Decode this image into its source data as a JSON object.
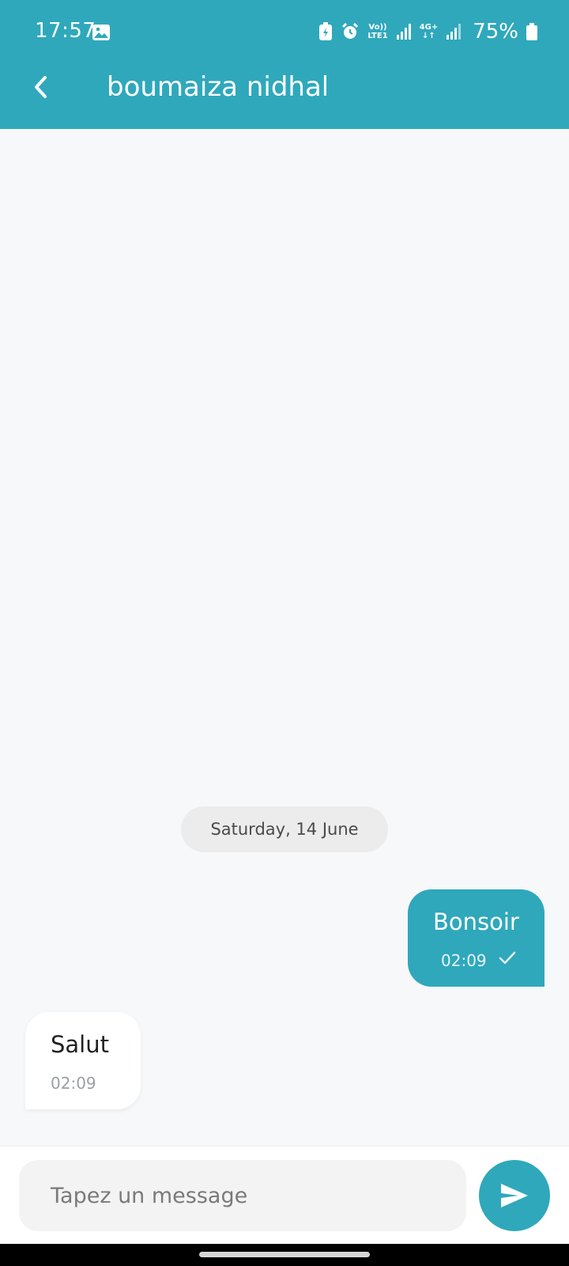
{
  "status_bar": {
    "time": "17:57",
    "volte_top": "Vo))",
    "volte_bottom": "LTE1",
    "network_top": "4G+",
    "network_bottom": "↓↑",
    "battery_percent": "75%"
  },
  "header": {
    "title": "boumaiza nidhal"
  },
  "conversation": {
    "date_separator": "Saturday, 14 June",
    "messages": [
      {
        "direction": "outgoing",
        "text": "Bonsoir",
        "time": "02:09",
        "status": "sent"
      },
      {
        "direction": "incoming",
        "text": "Salut",
        "time": "02:09"
      }
    ]
  },
  "composer": {
    "placeholder": "Tapez un message",
    "value": ""
  },
  "colors": {
    "primary": "#2fa8bc",
    "background": "#f7f8fa",
    "incoming_bubble": "#ffffff",
    "date_chip": "#ececec"
  }
}
